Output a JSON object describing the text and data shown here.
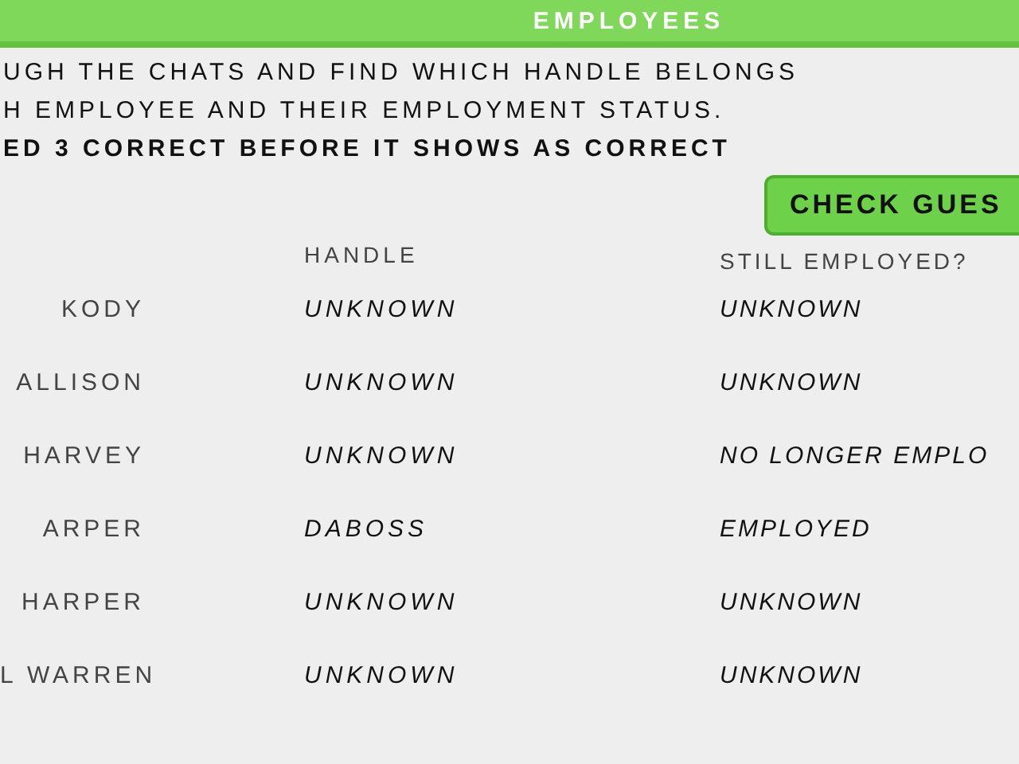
{
  "header": {
    "title": "EMPLOYEES"
  },
  "instructions": [
    "UGH THE CHATS AND FIND WHICH HANDLE BELONGS",
    "H EMPLOYEE AND THEIR EMPLOYMENT STATUS.",
    "ED 3 CORRECT BEFORE IT SHOWS AS CORRECT"
  ],
  "check_button": "CHECK GUES",
  "table": {
    "columns": [
      "HANDLE",
      "STILL EMPLOYED?"
    ],
    "rows": [
      {
        "name": "KODY",
        "handle": "UNKNOWN",
        "status": "UNKNOWN"
      },
      {
        "name": "ALLISON",
        "handle": "UNKNOWN",
        "status": "UNKNOWN"
      },
      {
        "name": "HARVEY",
        "handle": "UNKNOWN",
        "status": "NO LONGER EMPLO"
      },
      {
        "name": "ARPER",
        "handle": "DABOSS",
        "status": "EMPLOYED"
      },
      {
        "name": "HARPER",
        "handle": "UNKNOWN",
        "status": "UNKNOWN"
      },
      {
        "name": "L WARREN",
        "handle": "UNKNOWN",
        "status": "UNKNOWN"
      }
    ]
  }
}
